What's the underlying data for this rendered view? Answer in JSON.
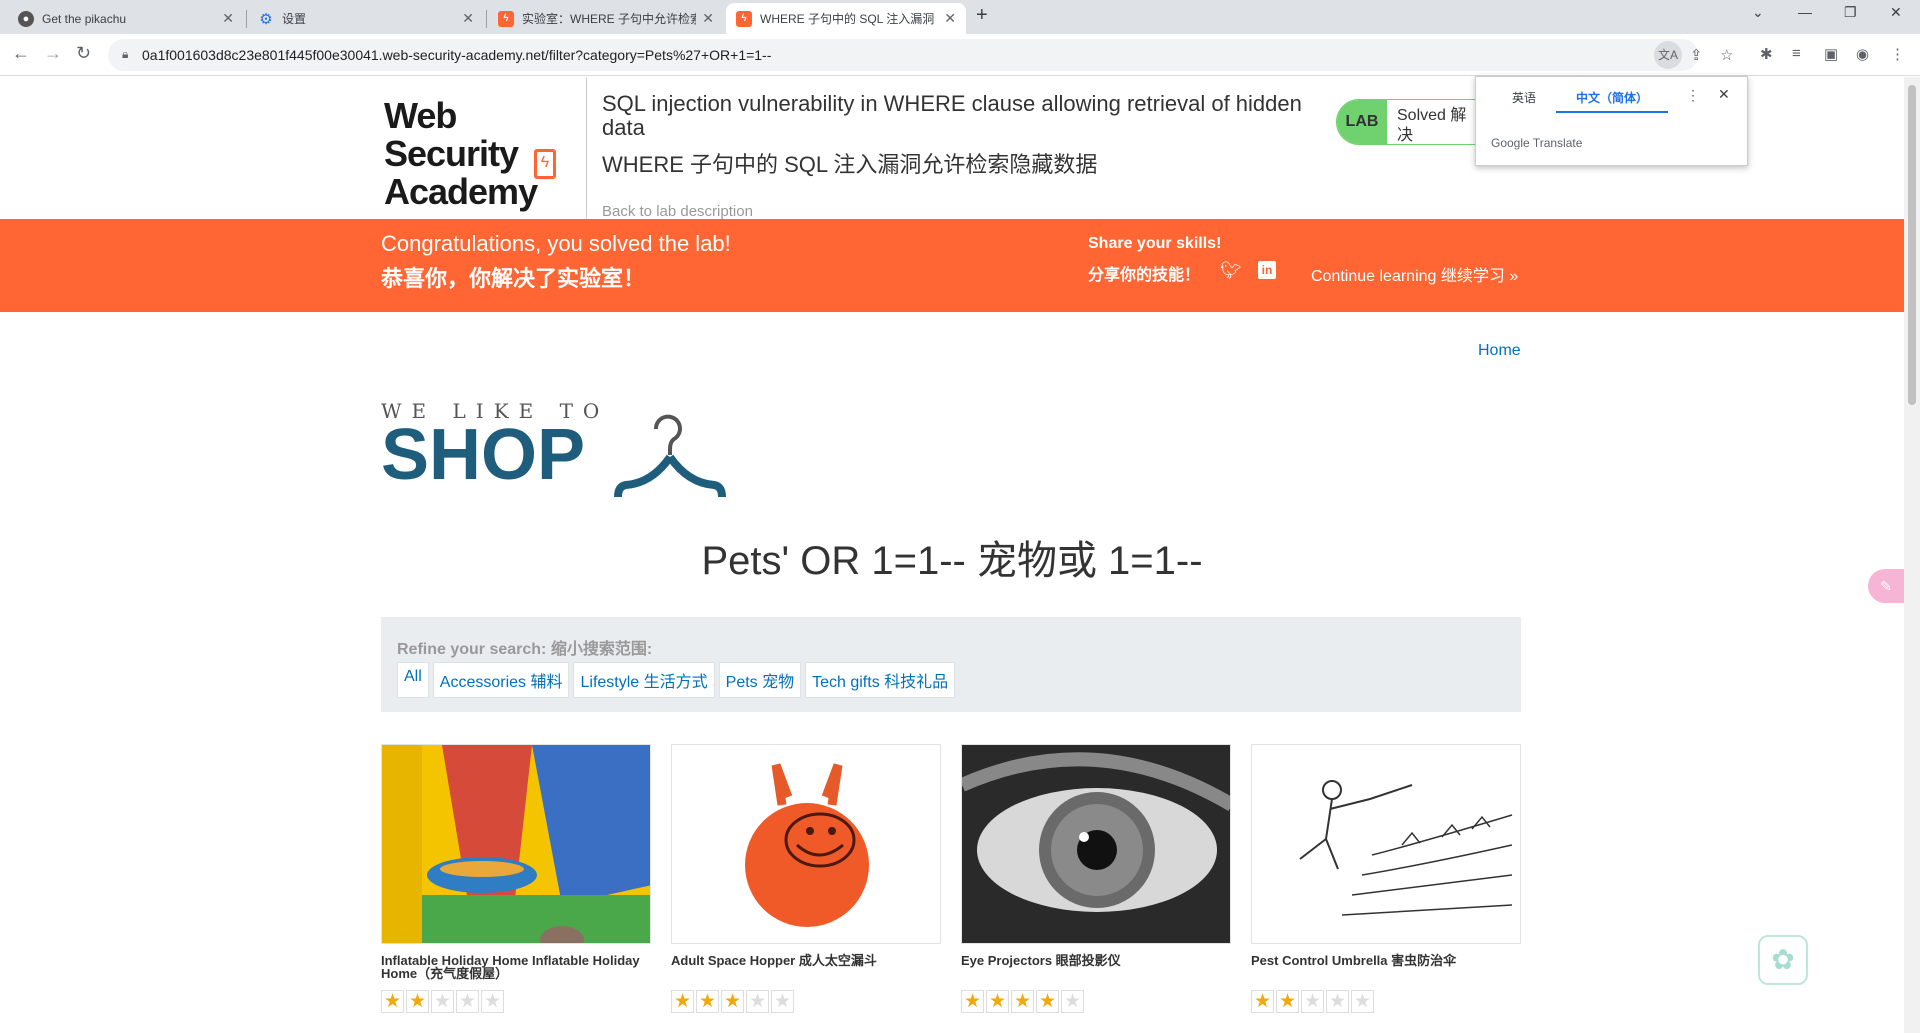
{
  "tabs": [
    {
      "title": "Get the pikachu",
      "icon": "github-icon"
    },
    {
      "title": "设置",
      "icon": "gear-icon"
    },
    {
      "title": "实验室：WHERE 子句中允许检索",
      "icon": "wsa-icon"
    },
    {
      "title": "WHERE 子句中的 SQL 注入漏洞",
      "icon": "wsa-icon"
    }
  ],
  "address_bar": {
    "url": "0a1f001603d8c23e801f445f00e30041.web-security-academy.net/filter?category=Pets%27+OR+1=1--"
  },
  "header": {
    "logo_line1": "Web Security",
    "logo_line2": "Academy",
    "title_en": "SQL injection vulnerability in WHERE clause allowing retrieval of hidden data",
    "title_zh": "WHERE 子句中的 SQL 注入漏洞允许检索隐藏数据",
    "back_link": "Back to lab description",
    "badge_lab": "LAB",
    "badge_state": "Solved 解决"
  },
  "translate_popup": {
    "source_lang": "英语",
    "target_lang": "中文（简体）",
    "brand": "Google Translate"
  },
  "congrats": {
    "message_en": "Congratulations, you solved the lab!",
    "message_zh": "恭喜你，你解决了实验室！",
    "share_en": "Share your skills!",
    "share_zh": "分享你的技能！",
    "continue": "Continue learning 继续学习 »"
  },
  "nav": {
    "home": "Home"
  },
  "shop_logo": {
    "tagline": "WE LIKE TO",
    "word": "SHOP"
  },
  "page_heading": "Pets' OR 1=1-- 宠物或 1=1--",
  "refine": {
    "label": "Refine your search: 缩小搜索范围:",
    "filters": [
      "All",
      "Accessories 辅料",
      "Lifestyle 生活方式",
      "Pets 宠物",
      "Tech gifts 科技礼品"
    ]
  },
  "products": [
    {
      "name": "Inflatable Holiday Home Inflatable Holiday Home（充气度假屋）",
      "rating": 2
    },
    {
      "name": "Adult Space Hopper 成人太空漏斗",
      "rating": 3
    },
    {
      "name": "Eye Projectors 眼部投影仪",
      "rating": 4
    },
    {
      "name": "Pest Control Umbrella 害虫防治伞",
      "rating": 2
    }
  ],
  "colors": {
    "accent": "#ff6633",
    "link": "#0071bc",
    "solved": "#70d16f",
    "shop": "#1f5d7c"
  }
}
